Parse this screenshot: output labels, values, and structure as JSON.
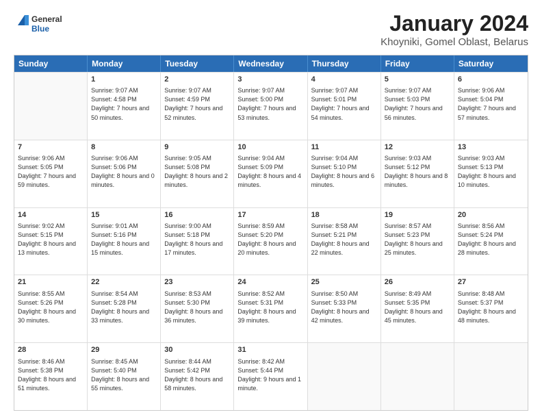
{
  "logo": {
    "line1": "General",
    "line2": "Blue"
  },
  "title": "January 2024",
  "subtitle": "Khoyniki, Gomel Oblast, Belarus",
  "header_days": [
    "Sunday",
    "Monday",
    "Tuesday",
    "Wednesday",
    "Thursday",
    "Friday",
    "Saturday"
  ],
  "weeks": [
    [
      {
        "day": "",
        "sunrise": "",
        "sunset": "",
        "daylight": ""
      },
      {
        "day": "1",
        "sunrise": "Sunrise: 9:07 AM",
        "sunset": "Sunset: 4:58 PM",
        "daylight": "Daylight: 7 hours and 50 minutes."
      },
      {
        "day": "2",
        "sunrise": "Sunrise: 9:07 AM",
        "sunset": "Sunset: 4:59 PM",
        "daylight": "Daylight: 7 hours and 52 minutes."
      },
      {
        "day": "3",
        "sunrise": "Sunrise: 9:07 AM",
        "sunset": "Sunset: 5:00 PM",
        "daylight": "Daylight: 7 hours and 53 minutes."
      },
      {
        "day": "4",
        "sunrise": "Sunrise: 9:07 AM",
        "sunset": "Sunset: 5:01 PM",
        "daylight": "Daylight: 7 hours and 54 minutes."
      },
      {
        "day": "5",
        "sunrise": "Sunrise: 9:07 AM",
        "sunset": "Sunset: 5:03 PM",
        "daylight": "Daylight: 7 hours and 56 minutes."
      },
      {
        "day": "6",
        "sunrise": "Sunrise: 9:06 AM",
        "sunset": "Sunset: 5:04 PM",
        "daylight": "Daylight: 7 hours and 57 minutes."
      }
    ],
    [
      {
        "day": "7",
        "sunrise": "Sunrise: 9:06 AM",
        "sunset": "Sunset: 5:05 PM",
        "daylight": "Daylight: 7 hours and 59 minutes."
      },
      {
        "day": "8",
        "sunrise": "Sunrise: 9:06 AM",
        "sunset": "Sunset: 5:06 PM",
        "daylight": "Daylight: 8 hours and 0 minutes."
      },
      {
        "day": "9",
        "sunrise": "Sunrise: 9:05 AM",
        "sunset": "Sunset: 5:08 PM",
        "daylight": "Daylight: 8 hours and 2 minutes."
      },
      {
        "day": "10",
        "sunrise": "Sunrise: 9:04 AM",
        "sunset": "Sunset: 5:09 PM",
        "daylight": "Daylight: 8 hours and 4 minutes."
      },
      {
        "day": "11",
        "sunrise": "Sunrise: 9:04 AM",
        "sunset": "Sunset: 5:10 PM",
        "daylight": "Daylight: 8 hours and 6 minutes."
      },
      {
        "day": "12",
        "sunrise": "Sunrise: 9:03 AM",
        "sunset": "Sunset: 5:12 PM",
        "daylight": "Daylight: 8 hours and 8 minutes."
      },
      {
        "day": "13",
        "sunrise": "Sunrise: 9:03 AM",
        "sunset": "Sunset: 5:13 PM",
        "daylight": "Daylight: 8 hours and 10 minutes."
      }
    ],
    [
      {
        "day": "14",
        "sunrise": "Sunrise: 9:02 AM",
        "sunset": "Sunset: 5:15 PM",
        "daylight": "Daylight: 8 hours and 13 minutes."
      },
      {
        "day": "15",
        "sunrise": "Sunrise: 9:01 AM",
        "sunset": "Sunset: 5:16 PM",
        "daylight": "Daylight: 8 hours and 15 minutes."
      },
      {
        "day": "16",
        "sunrise": "Sunrise: 9:00 AM",
        "sunset": "Sunset: 5:18 PM",
        "daylight": "Daylight: 8 hours and 17 minutes."
      },
      {
        "day": "17",
        "sunrise": "Sunrise: 8:59 AM",
        "sunset": "Sunset: 5:20 PM",
        "daylight": "Daylight: 8 hours and 20 minutes."
      },
      {
        "day": "18",
        "sunrise": "Sunrise: 8:58 AM",
        "sunset": "Sunset: 5:21 PM",
        "daylight": "Daylight: 8 hours and 22 minutes."
      },
      {
        "day": "19",
        "sunrise": "Sunrise: 8:57 AM",
        "sunset": "Sunset: 5:23 PM",
        "daylight": "Daylight: 8 hours and 25 minutes."
      },
      {
        "day": "20",
        "sunrise": "Sunrise: 8:56 AM",
        "sunset": "Sunset: 5:24 PM",
        "daylight": "Daylight: 8 hours and 28 minutes."
      }
    ],
    [
      {
        "day": "21",
        "sunrise": "Sunrise: 8:55 AM",
        "sunset": "Sunset: 5:26 PM",
        "daylight": "Daylight: 8 hours and 30 minutes."
      },
      {
        "day": "22",
        "sunrise": "Sunrise: 8:54 AM",
        "sunset": "Sunset: 5:28 PM",
        "daylight": "Daylight: 8 hours and 33 minutes."
      },
      {
        "day": "23",
        "sunrise": "Sunrise: 8:53 AM",
        "sunset": "Sunset: 5:30 PM",
        "daylight": "Daylight: 8 hours and 36 minutes."
      },
      {
        "day": "24",
        "sunrise": "Sunrise: 8:52 AM",
        "sunset": "Sunset: 5:31 PM",
        "daylight": "Daylight: 8 hours and 39 minutes."
      },
      {
        "day": "25",
        "sunrise": "Sunrise: 8:50 AM",
        "sunset": "Sunset: 5:33 PM",
        "daylight": "Daylight: 8 hours and 42 minutes."
      },
      {
        "day": "26",
        "sunrise": "Sunrise: 8:49 AM",
        "sunset": "Sunset: 5:35 PM",
        "daylight": "Daylight: 8 hours and 45 minutes."
      },
      {
        "day": "27",
        "sunrise": "Sunrise: 8:48 AM",
        "sunset": "Sunset: 5:37 PM",
        "daylight": "Daylight: 8 hours and 48 minutes."
      }
    ],
    [
      {
        "day": "28",
        "sunrise": "Sunrise: 8:46 AM",
        "sunset": "Sunset: 5:38 PM",
        "daylight": "Daylight: 8 hours and 51 minutes."
      },
      {
        "day": "29",
        "sunrise": "Sunrise: 8:45 AM",
        "sunset": "Sunset: 5:40 PM",
        "daylight": "Daylight: 8 hours and 55 minutes."
      },
      {
        "day": "30",
        "sunrise": "Sunrise: 8:44 AM",
        "sunset": "Sunset: 5:42 PM",
        "daylight": "Daylight: 8 hours and 58 minutes."
      },
      {
        "day": "31",
        "sunrise": "Sunrise: 8:42 AM",
        "sunset": "Sunset: 5:44 PM",
        "daylight": "Daylight: 9 hours and 1 minute."
      },
      {
        "day": "",
        "sunrise": "",
        "sunset": "",
        "daylight": ""
      },
      {
        "day": "",
        "sunrise": "",
        "sunset": "",
        "daylight": ""
      },
      {
        "day": "",
        "sunrise": "",
        "sunset": "",
        "daylight": ""
      }
    ]
  ]
}
